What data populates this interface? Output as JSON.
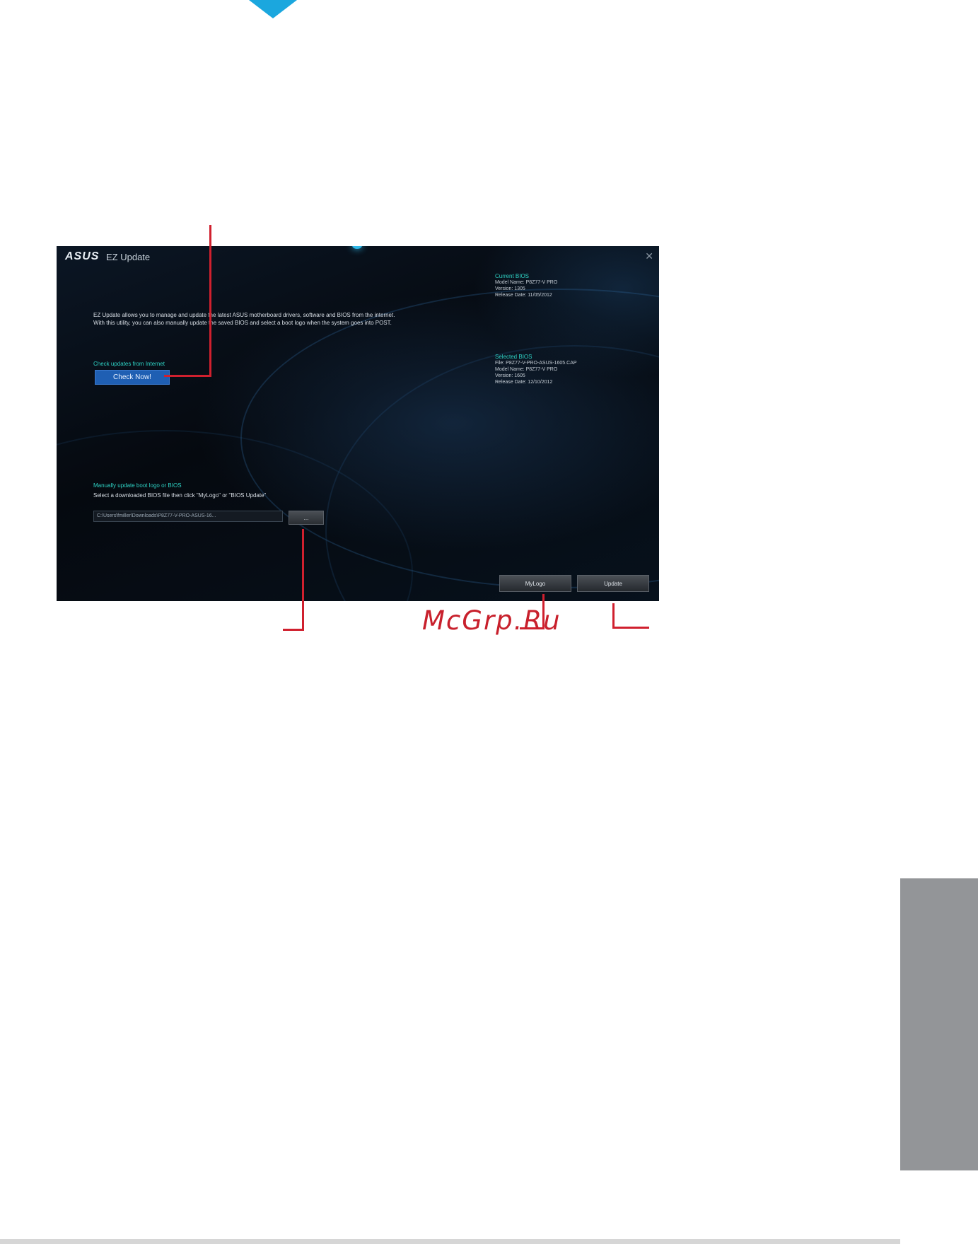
{
  "window": {
    "logo": "ASUS",
    "title": "EZ Update",
    "close_glyph": "✕"
  },
  "main": {
    "description": "EZ Update allows you to manage and update the latest ASUS motherboard drivers, software and BIOS from the internet. With this utility, you can also manually update the saved BIOS and select a boot logo when the system goes into POST.",
    "check_label": "Check updates from Internet",
    "check_button": "Check Now!",
    "manual_label": "Manually update boot logo or BIOS",
    "select_text": "Select a downloaded BIOS file then click \"MyLogo\" or \"BIOS Update\"",
    "path_value": "C:\\Users\\fmiller\\Downloads\\P8Z77-V-PRO-ASUS-16...",
    "browse_button": "...",
    "mylogo_button": "MyLogo",
    "update_button": "Update"
  },
  "current_bios": {
    "header": "Current BIOS",
    "model_name": "Model Name: P8Z77-V PRO",
    "version": "Version: 1305",
    "release_date": "Release Date: 11/05/2012"
  },
  "selected_bios": {
    "header": "Selected BIOS",
    "file": "File: P8Z77-V-PRO-ASUS-1605.CAP",
    "model_name": "Model Name: P8Z77-V PRO",
    "version": "Version: 1605",
    "release_date": "Release Date: 12/10/2012"
  },
  "watermark": "McGrp.Ru",
  "colors": {
    "accent_arrow": "#1ba7de",
    "callout_red": "#d0202e",
    "label_cyan": "#2ed2c4",
    "button_blue": "#1f5fb3",
    "side_tab_gray": "#939598"
  }
}
